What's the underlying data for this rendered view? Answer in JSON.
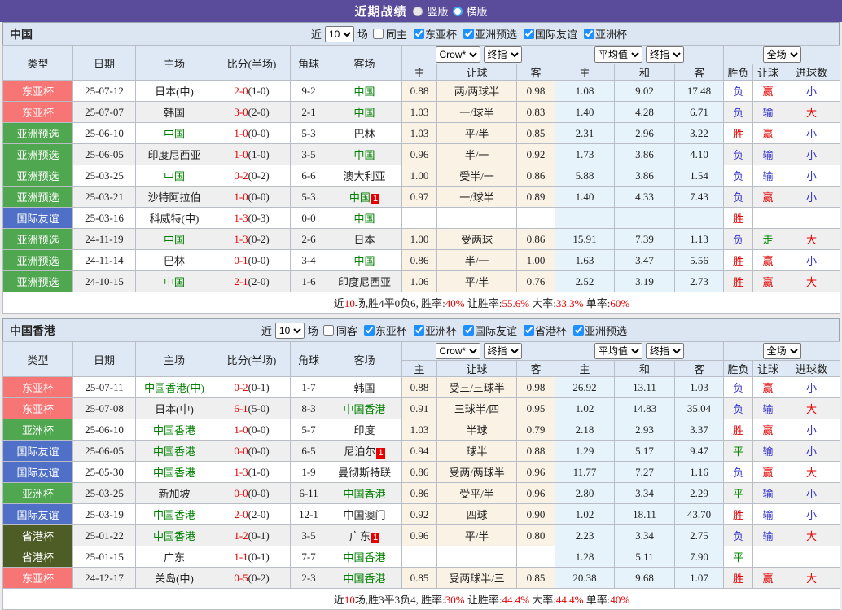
{
  "titlebar": {
    "title": "近期战绩",
    "vertical": "竖版",
    "horizontal": "横版",
    "selected": "横版"
  },
  "table_header": {
    "cols": [
      "类型",
      "日期",
      "主场",
      "比分(半场)",
      "角球",
      "客场"
    ],
    "dropdowns": {
      "bookmaker": "Crow*",
      "book_stage": "终指",
      "average": "平均值",
      "avg_stage": "终指",
      "scope": "全场"
    },
    "sub": [
      "主",
      "让球",
      "客",
      "主",
      "和",
      "客",
      "胜负",
      "让球",
      "进球数"
    ]
  },
  "type_class": {
    "东亚杯": "t-eac",
    "亚洲预选": "t-asia",
    "亚洲杯": "t-asia",
    "国际友谊": "t-fr",
    "省港杯": "t-sg"
  },
  "result_class": {
    "胜": "win",
    "赢": "win",
    "大": "win",
    "负": "lose",
    "输": "lose",
    "小": "lose",
    "平": "draw",
    "走": "draw"
  },
  "colors": {
    "titlebar_bg": "#5b4b9b",
    "filterbar_bg": "#dce6f2",
    "header_bg": "#dfe9f5",
    "row_alt_bg": "#efefef",
    "odds_bg": "#fbf2e6",
    "avg_bg": "#e6f3fa",
    "east_asia_cup": "#f87575",
    "asia_green": "#4fa74f",
    "friendly_blue": "#5070c8",
    "shenggang_olive": "#4e5c26",
    "red": "#e60000",
    "blue": "#3333cc",
    "green": "#008800",
    "team_green": "#008000"
  },
  "sections": [
    {
      "name": "中国",
      "filter": {
        "near": "近",
        "count": "10",
        "games": "场",
        "same": "同主",
        "cups": [
          "东亚杯",
          "亚洲预选",
          "国际友谊",
          "亚洲杯"
        ]
      },
      "rows": [
        {
          "t": "东亚杯",
          "d": "25-07-12",
          "h": "日本(中)",
          "hg": false,
          "hb": "",
          "s": "2-0",
          "sh": "(1-0)",
          "c": "9-2",
          "a": "中国",
          "ag": true,
          "ab": "",
          "o1": "0.88",
          "hc": "两/两球半",
          "o2": "0.98",
          "a1": "1.08",
          "a2": "9.02",
          "a3": "17.48",
          "r": "负",
          "hr": "赢",
          "g": "小"
        },
        {
          "t": "东亚杯",
          "d": "25-07-07",
          "h": "韩国",
          "hg": false,
          "hb": "",
          "s": "3-0",
          "sh": "(2-0)",
          "c": "2-1",
          "a": "中国",
          "ag": true,
          "ab": "",
          "o1": "1.03",
          "hc": "一/球半",
          "o2": "0.83",
          "a1": "1.40",
          "a2": "4.28",
          "a3": "6.71",
          "r": "负",
          "hr": "输",
          "g": "大"
        },
        {
          "t": "亚洲预选",
          "d": "25-06-10",
          "h": "中国",
          "hg": true,
          "hb": "",
          "s": "1-0",
          "sh": "(0-0)",
          "c": "5-3",
          "a": "巴林",
          "ag": false,
          "ab": "",
          "o1": "1.03",
          "hc": "平/半",
          "o2": "0.85",
          "a1": "2.31",
          "a2": "2.96",
          "a3": "3.22",
          "r": "胜",
          "hr": "赢",
          "g": "小"
        },
        {
          "t": "亚洲预选",
          "d": "25-06-05",
          "h": "印度尼西亚",
          "hg": false,
          "hb": "",
          "s": "1-0",
          "sh": "(1-0)",
          "c": "3-5",
          "a": "中国",
          "ag": true,
          "ab": "",
          "o1": "0.96",
          "hc": "半/一",
          "o2": "0.92",
          "a1": "1.73",
          "a2": "3.86",
          "a3": "4.10",
          "r": "负",
          "hr": "输",
          "g": "小"
        },
        {
          "t": "亚洲预选",
          "d": "25-03-25",
          "h": "中国",
          "hg": true,
          "hb": "",
          "s": "0-2",
          "sh": "(0-2)",
          "c": "6-6",
          "a": "澳大利亚",
          "ag": false,
          "ab": "",
          "o1": "1.00",
          "hc": "受半/一",
          "o2": "0.86",
          "a1": "5.88",
          "a2": "3.86",
          "a3": "1.54",
          "r": "负",
          "hr": "输",
          "g": "小"
        },
        {
          "t": "亚洲预选",
          "d": "25-03-21",
          "h": "沙特阿拉伯",
          "hg": false,
          "hb": "",
          "s": "1-0",
          "sh": "(0-0)",
          "c": "5-3",
          "a": "中国",
          "ag": true,
          "ab": "1",
          "o1": "0.97",
          "hc": "一/球半",
          "o2": "0.89",
          "a1": "1.40",
          "a2": "4.33",
          "a3": "7.43",
          "r": "负",
          "hr": "赢",
          "g": "小"
        },
        {
          "t": "国际友谊",
          "d": "25-03-16",
          "h": "科威特(中)",
          "hg": false,
          "hb": "",
          "s": "1-3",
          "sh": "(0-3)",
          "c": "0-0",
          "a": "中国",
          "ag": true,
          "ab": "",
          "o1": "",
          "hc": "",
          "o2": "",
          "a1": "",
          "a2": "",
          "a3": "",
          "r": "胜",
          "hr": "",
          "g": ""
        },
        {
          "t": "亚洲预选",
          "d": "24-11-19",
          "h": "中国",
          "hg": true,
          "hb": "",
          "s": "1-3",
          "sh": "(0-2)",
          "c": "2-6",
          "a": "日本",
          "ag": false,
          "ab": "",
          "o1": "1.00",
          "hc": "受两球",
          "o2": "0.86",
          "a1": "15.91",
          "a2": "7.39",
          "a3": "1.13",
          "r": "负",
          "hr": "走",
          "g": "大"
        },
        {
          "t": "亚洲预选",
          "d": "24-11-14",
          "h": "巴林",
          "hg": false,
          "hb": "",
          "s": "0-1",
          "sh": "(0-0)",
          "c": "3-4",
          "a": "中国",
          "ag": true,
          "ab": "",
          "o1": "0.86",
          "hc": "半/一",
          "o2": "1.00",
          "a1": "1.63",
          "a2": "3.47",
          "a3": "5.56",
          "r": "胜",
          "hr": "赢",
          "g": "小"
        },
        {
          "t": "亚洲预选",
          "d": "24-10-15",
          "h": "中国",
          "hg": true,
          "hb": "",
          "s": "2-1",
          "sh": "(2-0)",
          "c": "1-6",
          "a": "印度尼西亚",
          "ag": false,
          "ab": "",
          "o1": "1.06",
          "hc": "平/半",
          "o2": "0.76",
          "a1": "2.52",
          "a2": "3.19",
          "a3": "2.73",
          "r": "胜",
          "hr": "赢",
          "g": "大"
        }
      ],
      "summary": [
        [
          "近",
          ""
        ],
        [
          "10",
          "r"
        ],
        [
          "场,胜4平0负6, 胜率:",
          ""
        ],
        [
          "40%",
          "r"
        ],
        [
          " 让胜率:",
          ""
        ],
        [
          "55.6%",
          "r"
        ],
        [
          " 大率:",
          ""
        ],
        [
          "33.3%",
          "r"
        ],
        [
          " 单率:",
          ""
        ],
        [
          "60%",
          "r"
        ]
      ]
    },
    {
      "name": "中国香港",
      "filter": {
        "near": "近",
        "count": "10",
        "games": "场",
        "same": "同客",
        "cups": [
          "东亚杯",
          "亚洲杯",
          "国际友谊",
          "省港杯",
          "亚洲预选"
        ]
      },
      "rows": [
        {
          "t": "东亚杯",
          "d": "25-07-11",
          "h": "中国香港(中)",
          "hg": true,
          "hb": "",
          "s": "0-2",
          "sh": "(0-1)",
          "c": "1-7",
          "a": "韩国",
          "ag": false,
          "ab": "",
          "o1": "0.88",
          "hc": "受三/三球半",
          "o2": "0.98",
          "a1": "26.92",
          "a2": "13.11",
          "a3": "1.03",
          "r": "负",
          "hr": "赢",
          "g": "小"
        },
        {
          "t": "东亚杯",
          "d": "25-07-08",
          "h": "日本(中)",
          "hg": false,
          "hb": "",
          "s": "6-1",
          "sh": "(5-0)",
          "c": "8-3",
          "a": "中国香港",
          "ag": true,
          "ab": "",
          "o1": "0.91",
          "hc": "三球半/四",
          "o2": "0.95",
          "a1": "1.02",
          "a2": "14.83",
          "a3": "35.04",
          "r": "负",
          "hr": "输",
          "g": "大"
        },
        {
          "t": "亚洲杯",
          "d": "25-06-10",
          "h": "中国香港",
          "hg": true,
          "hb": "",
          "s": "1-0",
          "sh": "(0-0)",
          "c": "5-7",
          "a": "印度",
          "ag": false,
          "ab": "",
          "o1": "1.03",
          "hc": "半球",
          "o2": "0.79",
          "a1": "2.18",
          "a2": "2.93",
          "a3": "3.37",
          "r": "胜",
          "hr": "赢",
          "g": "小"
        },
        {
          "t": "国际友谊",
          "d": "25-06-05",
          "h": "中国香港",
          "hg": true,
          "hb": "",
          "s": "0-0",
          "sh": "(0-0)",
          "c": "6-5",
          "a": "尼泊尔",
          "ag": false,
          "ab": "1",
          "o1": "0.94",
          "hc": "球半",
          "o2": "0.88",
          "a1": "1.29",
          "a2": "5.17",
          "a3": "9.47",
          "r": "平",
          "hr": "输",
          "g": "小"
        },
        {
          "t": "国际友谊",
          "d": "25-05-30",
          "h": "中国香港",
          "hg": true,
          "hb": "",
          "s": "1-3",
          "sh": "(1-0)",
          "c": "1-9",
          "a": "曼彻斯特联",
          "ag": false,
          "ab": "",
          "o1": "0.86",
          "hc": "受两/两球半",
          "o2": "0.96",
          "a1": "11.77",
          "a2": "7.27",
          "a3": "1.16",
          "r": "负",
          "hr": "赢",
          "g": "大"
        },
        {
          "t": "亚洲杯",
          "d": "25-03-25",
          "h": "新加坡",
          "hg": false,
          "hb": "",
          "s": "0-0",
          "sh": "(0-0)",
          "c": "6-11",
          "a": "中国香港",
          "ag": true,
          "ab": "",
          "o1": "0.86",
          "hc": "受平/半",
          "o2": "0.96",
          "a1": "2.80",
          "a2": "3.34",
          "a3": "2.29",
          "r": "平",
          "hr": "输",
          "g": "小"
        },
        {
          "t": "国际友谊",
          "d": "25-03-19",
          "h": "中国香港",
          "hg": true,
          "hb": "",
          "s": "2-0",
          "sh": "(2-0)",
          "c": "12-1",
          "a": "中国澳门",
          "ag": false,
          "ab": "",
          "o1": "0.92",
          "hc": "四球",
          "o2": "0.90",
          "a1": "1.02",
          "a2": "18.11",
          "a3": "43.70",
          "r": "胜",
          "hr": "输",
          "g": "小"
        },
        {
          "t": "省港杯",
          "d": "25-01-22",
          "h": "中国香港",
          "hg": true,
          "hb": "",
          "s": "1-2",
          "sh": "(0-1)",
          "c": "3-5",
          "a": "广东",
          "ag": false,
          "ab": "1",
          "o1": "0.96",
          "hc": "平/半",
          "o2": "0.80",
          "a1": "2.23",
          "a2": "3.34",
          "a3": "2.75",
          "r": "负",
          "hr": "输",
          "g": "大"
        },
        {
          "t": "省港杯",
          "d": "25-01-15",
          "h": "广东",
          "hg": false,
          "hb": "",
          "s": "1-1",
          "sh": "(0-1)",
          "c": "7-7",
          "a": "中国香港",
          "ag": true,
          "ab": "",
          "o1": "",
          "hc": "",
          "o2": "",
          "a1": "1.28",
          "a2": "5.11",
          "a3": "7.90",
          "r": "平",
          "hr": "",
          "g": ""
        },
        {
          "t": "东亚杯",
          "d": "24-12-17",
          "h": "关岛(中)",
          "hg": false,
          "hb": "",
          "s": "0-5",
          "sh": "(0-2)",
          "c": "2-3",
          "a": "中国香港",
          "ag": true,
          "ab": "",
          "o1": "0.85",
          "hc": "受两球半/三",
          "o2": "0.85",
          "a1": "20.38",
          "a2": "9.68",
          "a3": "1.07",
          "r": "胜",
          "hr": "赢",
          "g": "大"
        }
      ],
      "summary": [
        [
          "近",
          ""
        ],
        [
          "10",
          "r"
        ],
        [
          "场,胜3平3负4, 胜率:",
          ""
        ],
        [
          "30%",
          "r"
        ],
        [
          " 让胜率:",
          ""
        ],
        [
          "44.4%",
          "r"
        ],
        [
          " 大率:",
          ""
        ],
        [
          "44.4%",
          "r"
        ],
        [
          " 单率:",
          ""
        ],
        [
          "40%",
          "r"
        ]
      ]
    }
  ]
}
